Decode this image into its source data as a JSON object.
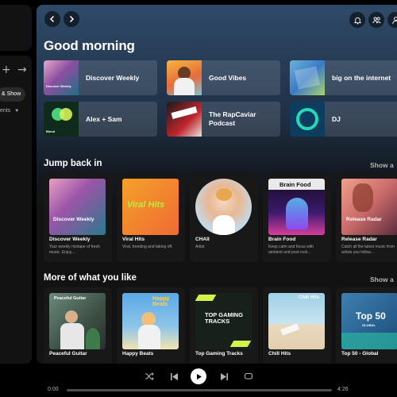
{
  "sidebar": {
    "add_icon": "plus-icon",
    "expand_icon": "arrow-right-icon",
    "chip_label": "& Show",
    "recents_label": "ents",
    "recents_icon": "caret-down-icon"
  },
  "header": {
    "back_icon": "chevron-left-icon",
    "forward_icon": "chevron-right-icon",
    "icons": [
      "bell-icon",
      "friends-icon",
      "user-icon"
    ]
  },
  "greeting": "Good morning",
  "shortcuts": [
    {
      "label": "Discover Weekly",
      "art_text": "Discover Weekly"
    },
    {
      "label": "Good Vibes",
      "art_text": ""
    },
    {
      "label": "big on the internet",
      "art_text": ""
    },
    {
      "label": "Alex + Sam",
      "art_text": "Blend"
    },
    {
      "label": "The RapCaviar Podcast",
      "art_text": ""
    },
    {
      "label": "DJ",
      "art_text": ""
    }
  ],
  "jump_back": {
    "title": "Jump back in",
    "show_all": "Show a",
    "cards": [
      {
        "title": "Discover Weekly",
        "desc": "Your weekly mixtape of fresh music. Enjoy...",
        "art_text": "Discover Weekly"
      },
      {
        "title": "Viral Hits",
        "desc": "Viral, trending and taking off.",
        "art_text": "Viral Hits"
      },
      {
        "title": "CHAII",
        "desc": "Artist",
        "art_text": ""
      },
      {
        "title": "Brain Food",
        "desc": "Keep calm and focus with ambient and post-rock...",
        "art_text": "Brain Food"
      },
      {
        "title": "Release Radar",
        "desc": "Catch all the latest music from artists you follow...",
        "art_text": "Release Radar"
      }
    ]
  },
  "more_like": {
    "title": "More of what you like",
    "show_all": "Show a",
    "cards": [
      {
        "title": "Peaceful Guitar",
        "desc": "",
        "art_text": "Peaceful Guitar"
      },
      {
        "title": "Happy Beats",
        "desc": "",
        "art_text": "Happy Beats"
      },
      {
        "title": "Top Gaming Tracks",
        "desc": "",
        "art_text": "TOP GAMING TRACKS"
      },
      {
        "title": "Chill Hits",
        "desc": "",
        "art_text": "Chill Hits"
      },
      {
        "title": "Top 50 - Global",
        "desc": "",
        "art_text": "Top 50",
        "art_sub": "GLOBAL"
      }
    ]
  },
  "player": {
    "shuffle_icon": "shuffle-icon",
    "prev_icon": "skip-back-icon",
    "play_icon": "play-icon",
    "next_icon": "skip-forward-icon",
    "repeat_icon": "repeat-icon",
    "elapsed": "0:00",
    "duration": "4:26",
    "progress": 0
  },
  "colors": {
    "accent_green": "#1db954",
    "header_gradient": "#2f4a68",
    "surface": "#121212"
  }
}
